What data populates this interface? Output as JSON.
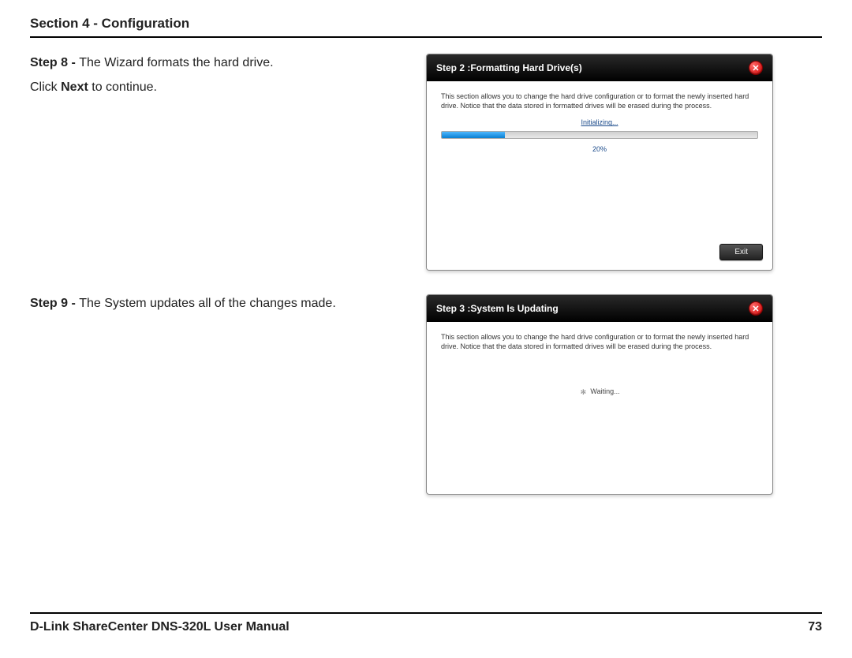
{
  "header": {
    "section_title": "Section 4 - Configuration"
  },
  "step8": {
    "label": "Step 8 - ",
    "text": "The Wizard formats the hard drive.",
    "click_prefix": "Click ",
    "click_bold": "Next",
    "click_suffix": " to continue."
  },
  "step9": {
    "label": "Step 9 - ",
    "text": "The System updates all of the changes made."
  },
  "wizard1": {
    "title": "Step 2 :Formatting Hard Drive(s)",
    "desc": "This section allows you to change the hard drive configuration or to format the newly inserted hard drive. Notice that the data stored in formatted drives will be erased during the process.",
    "progress_label": "Initializing...",
    "progress_pct_value": 20,
    "progress_pct_text": "20%",
    "exit_label": "Exit"
  },
  "wizard2": {
    "title": "Step 3 :System Is Updating",
    "desc": "This section allows you to change the hard drive configuration or to format the newly inserted hard drive. Notice that the data stored in formatted drives will be erased during the process.",
    "waiting_text": "Waiting..."
  },
  "footer": {
    "manual": "D-Link ShareCenter DNS-320L User Manual",
    "page": "73"
  }
}
